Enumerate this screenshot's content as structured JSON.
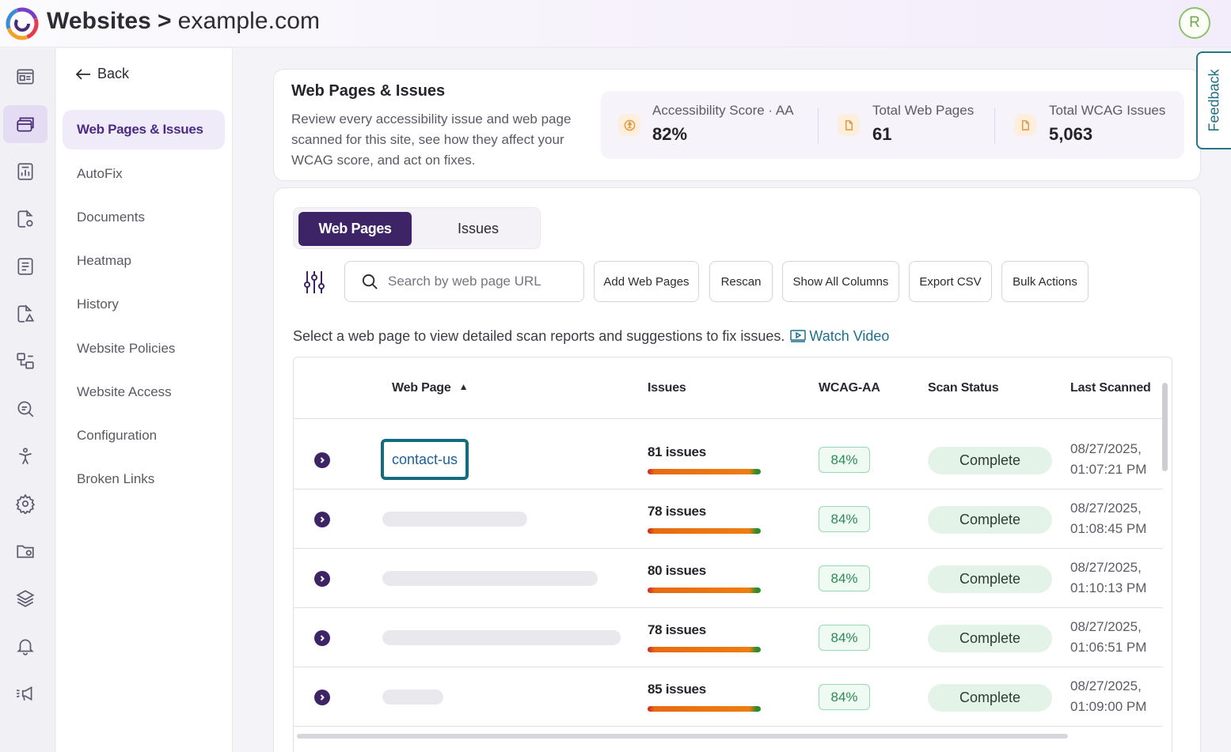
{
  "header": {
    "crumb_root": "Websites",
    "crumb_sep": ">",
    "crumb_site": "example.com",
    "avatar_initial": "R"
  },
  "rail": {
    "icons": [
      "dashboard-icon",
      "web-pages-icon",
      "reports-icon",
      "document-settings-icon",
      "text-document-icon",
      "document-warning-icon",
      "mapping-icon",
      "search-analysis-icon",
      "accessibility-icon",
      "settings-icon",
      "folder-settings-icon",
      "layers-icon",
      "bell-icon",
      "announcement-icon"
    ],
    "active_index": 1
  },
  "subnav": {
    "back_label": "Back",
    "items": [
      {
        "label": "Web Pages & Issues",
        "active": true
      },
      {
        "label": "AutoFix"
      },
      {
        "label": "Documents"
      },
      {
        "label": "Heatmap"
      },
      {
        "label": "History"
      },
      {
        "label": "Website Policies"
      },
      {
        "label": "Website Access"
      },
      {
        "label": "Configuration"
      },
      {
        "label": "Broken Links"
      }
    ]
  },
  "summary": {
    "title": "Web Pages & Issues",
    "description": "Review every accessibility issue and web page scanned for this site, see how they affect your WCAG score, and act on fixes.",
    "stats": [
      {
        "label": "Accessibility Score · AA",
        "value": "82%",
        "icon": "accessibility-icon"
      },
      {
        "label": "Total Web Pages",
        "value": "61",
        "icon": "page-icon"
      },
      {
        "label": "Total WCAG Issues",
        "value": "5,063",
        "icon": "page-icon"
      }
    ]
  },
  "feedback_label": "Feedback",
  "tabs": {
    "web_pages": "Web Pages",
    "issues": "Issues",
    "active": "web_pages"
  },
  "toolbar": {
    "search_placeholder": "Search by web page URL",
    "search_value": "",
    "buttons": [
      "Add Web Pages",
      "Rescan",
      "Show All Columns",
      "Export CSV",
      "Bulk Actions"
    ]
  },
  "hint": {
    "text": "Select a web page to view detailed scan reports and suggestions to fix issues.",
    "video_link": "Watch Video"
  },
  "table": {
    "columns": [
      "Web Page",
      "Issues",
      "WCAG-AA",
      "Scan Status",
      "Last Scanned"
    ],
    "sort_indicator": "▲",
    "rows": [
      {
        "page": "contact-us",
        "issues": "81 issues",
        "wcag": "84%",
        "status": "Complete",
        "date": "08/27/2025,",
        "time": "01:07:21 PM"
      },
      {
        "page": "",
        "issues": "78 issues",
        "wcag": "84%",
        "status": "Complete",
        "date": "08/27/2025,",
        "time": "01:08:45 PM"
      },
      {
        "page": "",
        "issues": "80 issues",
        "wcag": "84%",
        "status": "Complete",
        "date": "08/27/2025,",
        "time": "01:10:13 PM"
      },
      {
        "page": "",
        "issues": "78 issues",
        "wcag": "84%",
        "status": "Complete",
        "date": "08/27/2025,",
        "time": "01:06:51 PM"
      },
      {
        "page": "",
        "issues": "85 issues",
        "wcag": "84%",
        "status": "Complete",
        "date": "08/27/2025,",
        "time": "01:09:00 PM"
      }
    ]
  },
  "colors": {
    "brand_purple": "#3d2466",
    "accent_teal": "#136b7d",
    "score_green": "#2c8a57"
  }
}
